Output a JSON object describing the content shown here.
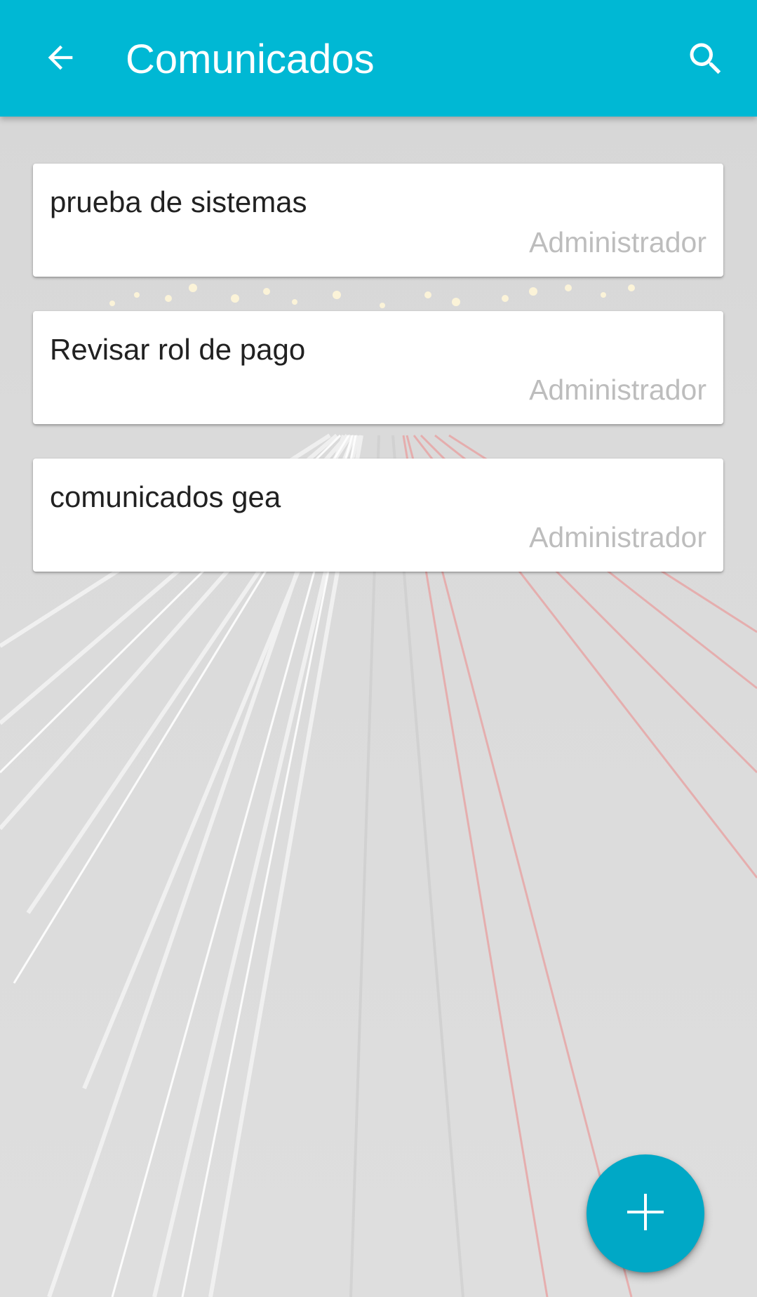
{
  "app_bar": {
    "title": "Comunicados",
    "back_icon": "arrow-left-icon",
    "search_icon": "search-icon",
    "color": "#00b8d4"
  },
  "announcements": [
    {
      "title": "prueba de sistemas",
      "author": "Administrador"
    },
    {
      "title": "Revisar rol de pago",
      "author": "Administrador"
    },
    {
      "title": "comunicados gea",
      "author": "Administrador"
    }
  ],
  "fab": {
    "icon": "plus-icon",
    "color": "#00a8c6"
  },
  "background": {
    "description_icon": "highway-light-trails-image"
  }
}
